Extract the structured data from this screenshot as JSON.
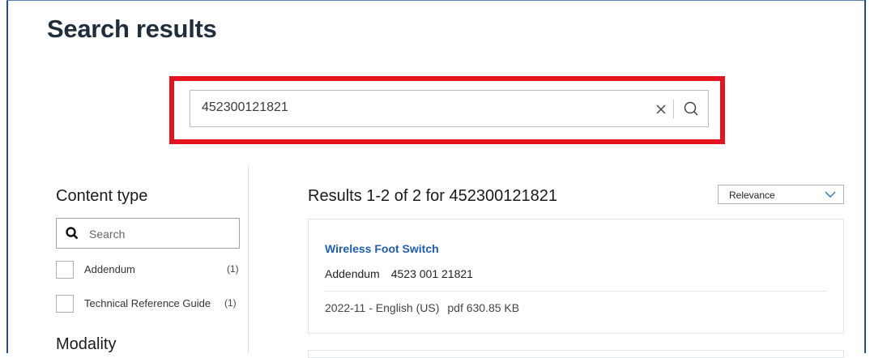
{
  "page": {
    "title": "Search results"
  },
  "search": {
    "query": "452300121821",
    "clear_icon": "close-icon",
    "submit_icon": "search-icon"
  },
  "annotation": {
    "highlight_color": "#e3141d"
  },
  "filters": {
    "content_type": {
      "title": "Content type",
      "search_placeholder": "Search",
      "options": [
        {
          "label": "Addendum",
          "count": "(1)",
          "checked": false
        },
        {
          "label": "Technical Reference Guide",
          "count": "(1)",
          "checked": false
        }
      ]
    },
    "modality": {
      "title": "Modality"
    }
  },
  "results": {
    "summary": "Results 1-2 of 2 for 452300121821",
    "sort": {
      "selected": "Relevance"
    },
    "items": [
      {
        "title": "Wireless Foot Switch",
        "doc_type": "Addendum",
        "doc_number": "4523 001 21821",
        "date_lang": "2022-11 - English (US)",
        "file": "pdf 630.85 KB"
      }
    ]
  },
  "colors": {
    "title": "#1f2d3d",
    "link": "#1d5fae",
    "frame": "#1f4f8a"
  }
}
